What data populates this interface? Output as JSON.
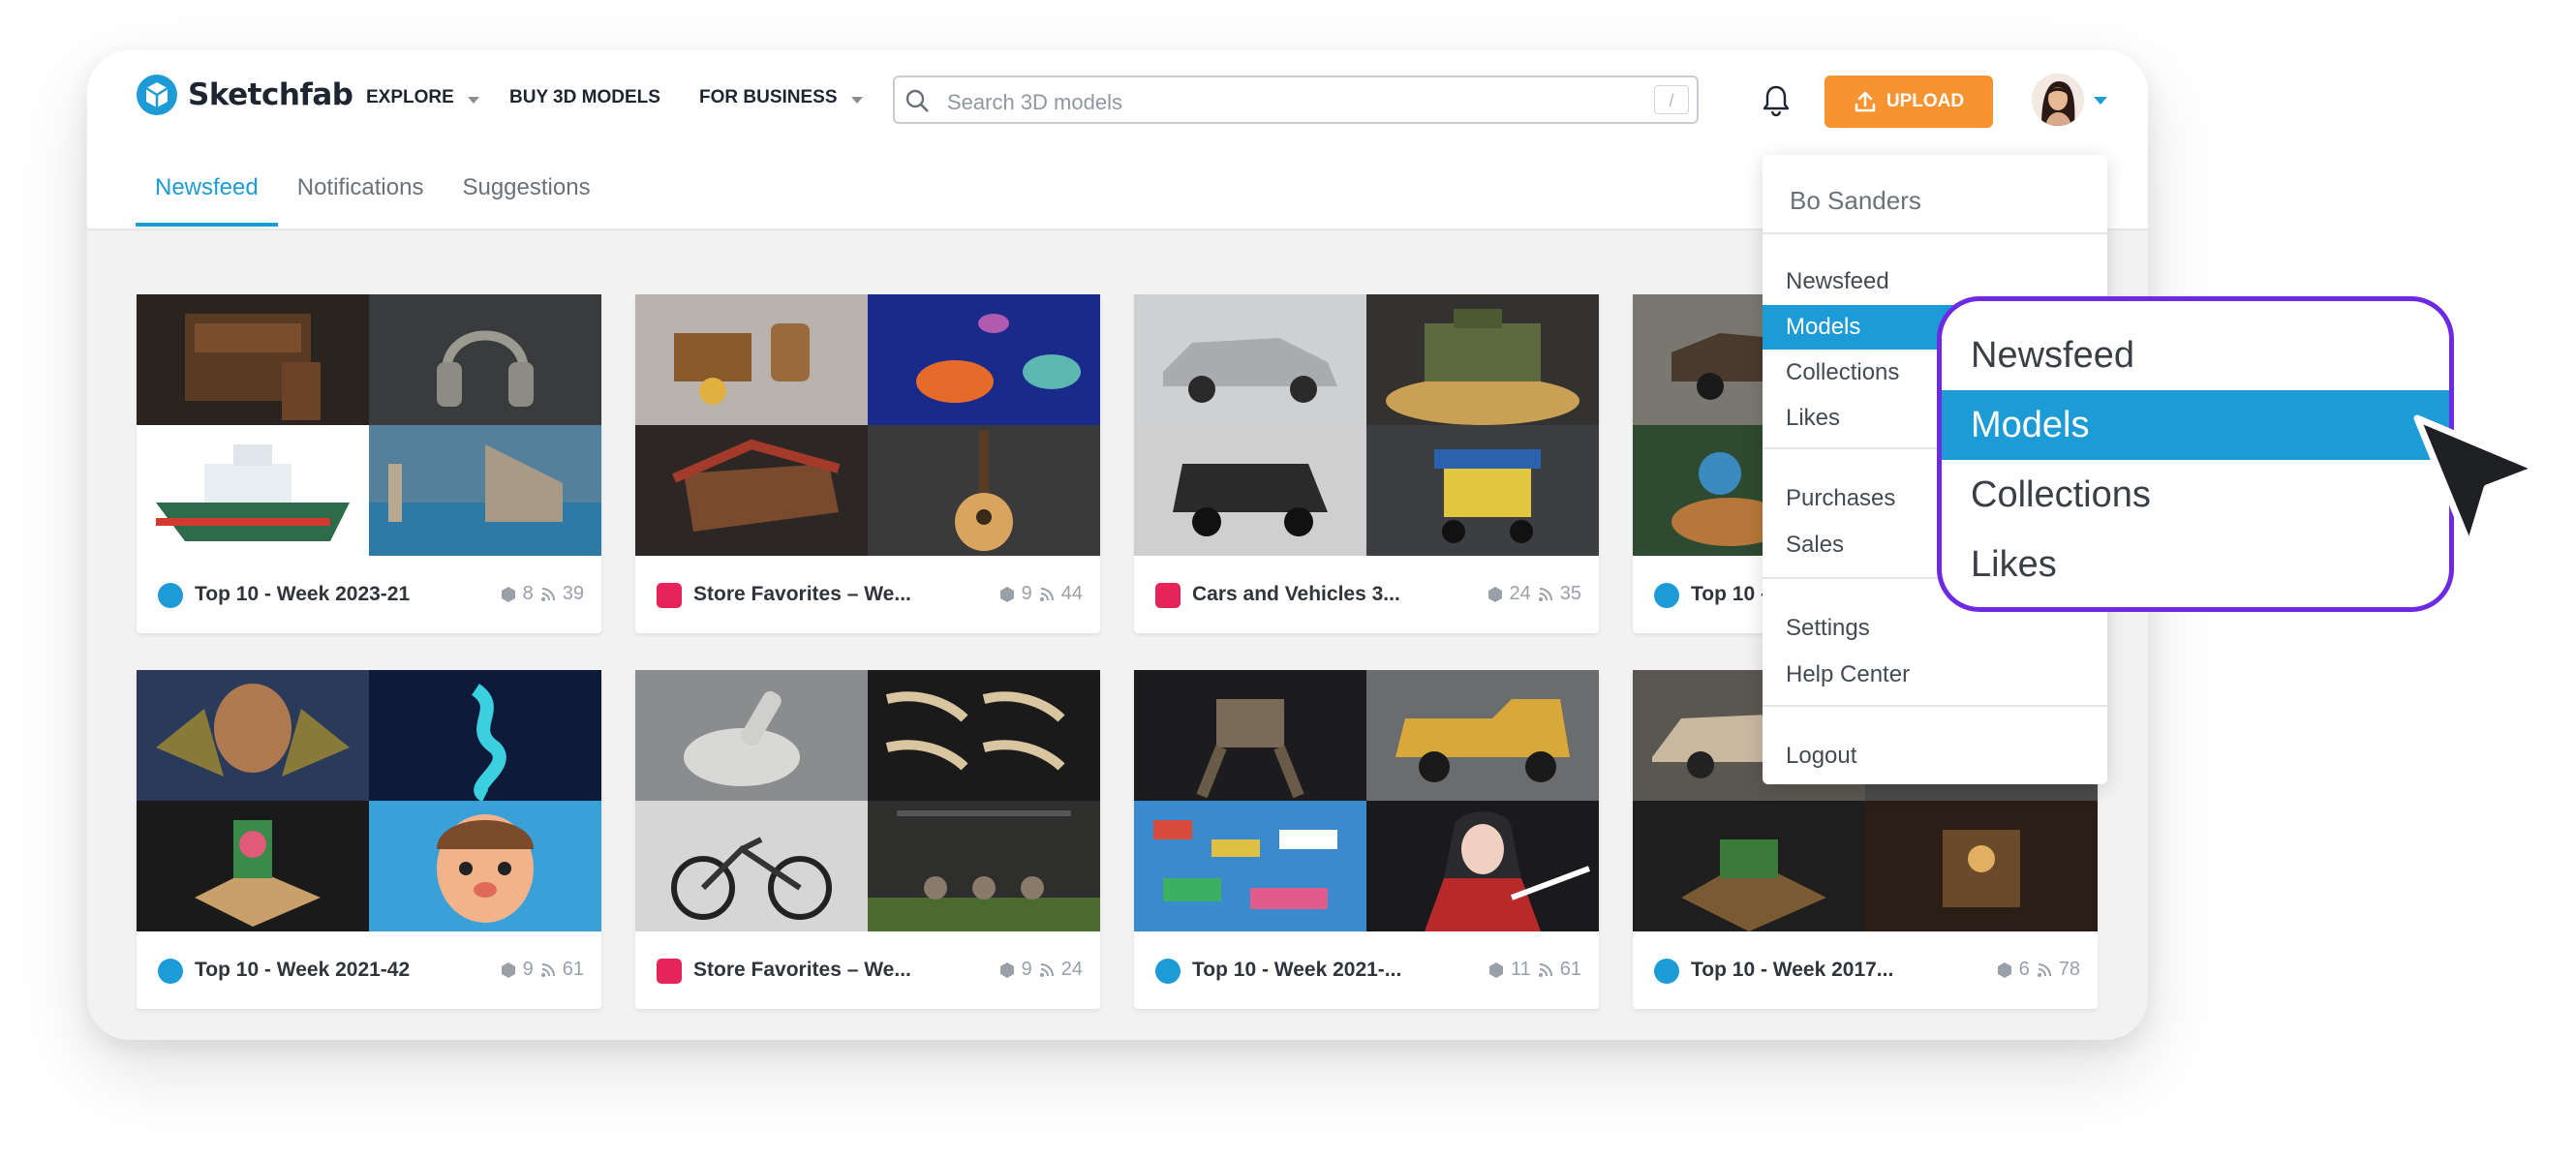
{
  "brand": {
    "name": "Sketchfab",
    "color": "#1c9bd6"
  },
  "nav": {
    "explore": "EXPLORE",
    "buy": "BUY 3D MODELS",
    "business": "FOR BUSINESS"
  },
  "search": {
    "placeholder": "Search 3D models",
    "shortcut": "/"
  },
  "upload": {
    "label": "UPLOAD",
    "color": "#f79431"
  },
  "tabs": [
    {
      "label": "Newsfeed",
      "active": true
    },
    {
      "label": "Notifications",
      "active": false
    },
    {
      "label": "Suggestions",
      "active": false
    }
  ],
  "cards": [
    {
      "title": "Top 10 - Week 2023-21",
      "kind": "staff",
      "models": "8",
      "followers": "39"
    },
    {
      "title": "Store Favorites – We...",
      "kind": "store",
      "models": "9",
      "followers": "44"
    },
    {
      "title": "Cars and Vehicles 3...",
      "kind": "store",
      "models": "24",
      "followers": "35"
    },
    {
      "title": "Top 10 -",
      "kind": "staff",
      "models": "",
      "followers": ""
    },
    {
      "title": "Top 10 - Week 2021-42",
      "kind": "staff",
      "models": "9",
      "followers": "61"
    },
    {
      "title": "Store Favorites – We...",
      "kind": "store",
      "models": "9",
      "followers": "24"
    },
    {
      "title": "Top 10 - Week 2021-...",
      "kind": "staff",
      "models": "11",
      "followers": "61"
    },
    {
      "title": "Top 10 - Week 2017...",
      "kind": "staff",
      "models": "6",
      "followers": "78"
    }
  ],
  "dropdown": {
    "user": "Bo Sanders",
    "items": [
      "Newsfeed",
      "Models",
      "Collections",
      "Likes",
      "Purchases",
      "Sales",
      "Settings",
      "Help Center",
      "Logout"
    ],
    "active": "Models"
  },
  "zoom": {
    "items": [
      "Newsfeed",
      "Models",
      "Collections",
      "Likes"
    ],
    "active": "Models",
    "border_color": "#6d2ae2"
  },
  "icons": [
    "sketchfab-logo-icon",
    "search-icon",
    "bell-icon",
    "upload-icon",
    "chevron-down-icon",
    "cube-icon",
    "follow-icon",
    "cursor-arrow-icon"
  ]
}
